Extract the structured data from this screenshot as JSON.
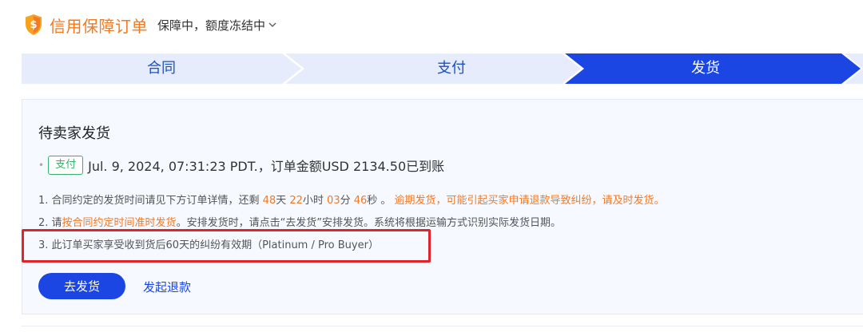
{
  "header": {
    "title": "信用保障订单",
    "status": "保障中，额度冻结中",
    "icon": "shield-dollar-icon",
    "accent_color": "#f5791f"
  },
  "steps": [
    {
      "label": "合同",
      "state": "done"
    },
    {
      "label": "支付",
      "state": "done"
    },
    {
      "label": "发货",
      "state": "active"
    }
  ],
  "panel": {
    "title": "待卖家发货",
    "payment": {
      "tag": "支付",
      "text": "Jul. 9, 2024, 07:31:23 PDT.，订单金额USD 2134.50已到账"
    },
    "notes": {
      "n1": {
        "prefix": "1. 合同约定的发货时间请见下方订单详情，还剩 ",
        "days": "48",
        "d_unit": "天 ",
        "hours": "22",
        "h_unit": "小时 ",
        "minutes": "03",
        "m_unit": "分 ",
        "seconds": "46",
        "s_unit": "秒 。 ",
        "warning": "逾期发货，可能引起买家申请退款导致纠纷，请及时发货。"
      },
      "n2": {
        "prefix": "2. 请",
        "highlight": "按合同约定时间准时发货",
        "suffix": "。安排发货时，请点击“去发货”安排发货。系统将根据运输方式识别实际发货日期。"
      },
      "n3": "3. 此订单买家享受收到货后60天的纠纷有效期（Platinum / Pro Buyer）"
    },
    "primary_button": "去发货",
    "secondary_link": "发起退款"
  }
}
